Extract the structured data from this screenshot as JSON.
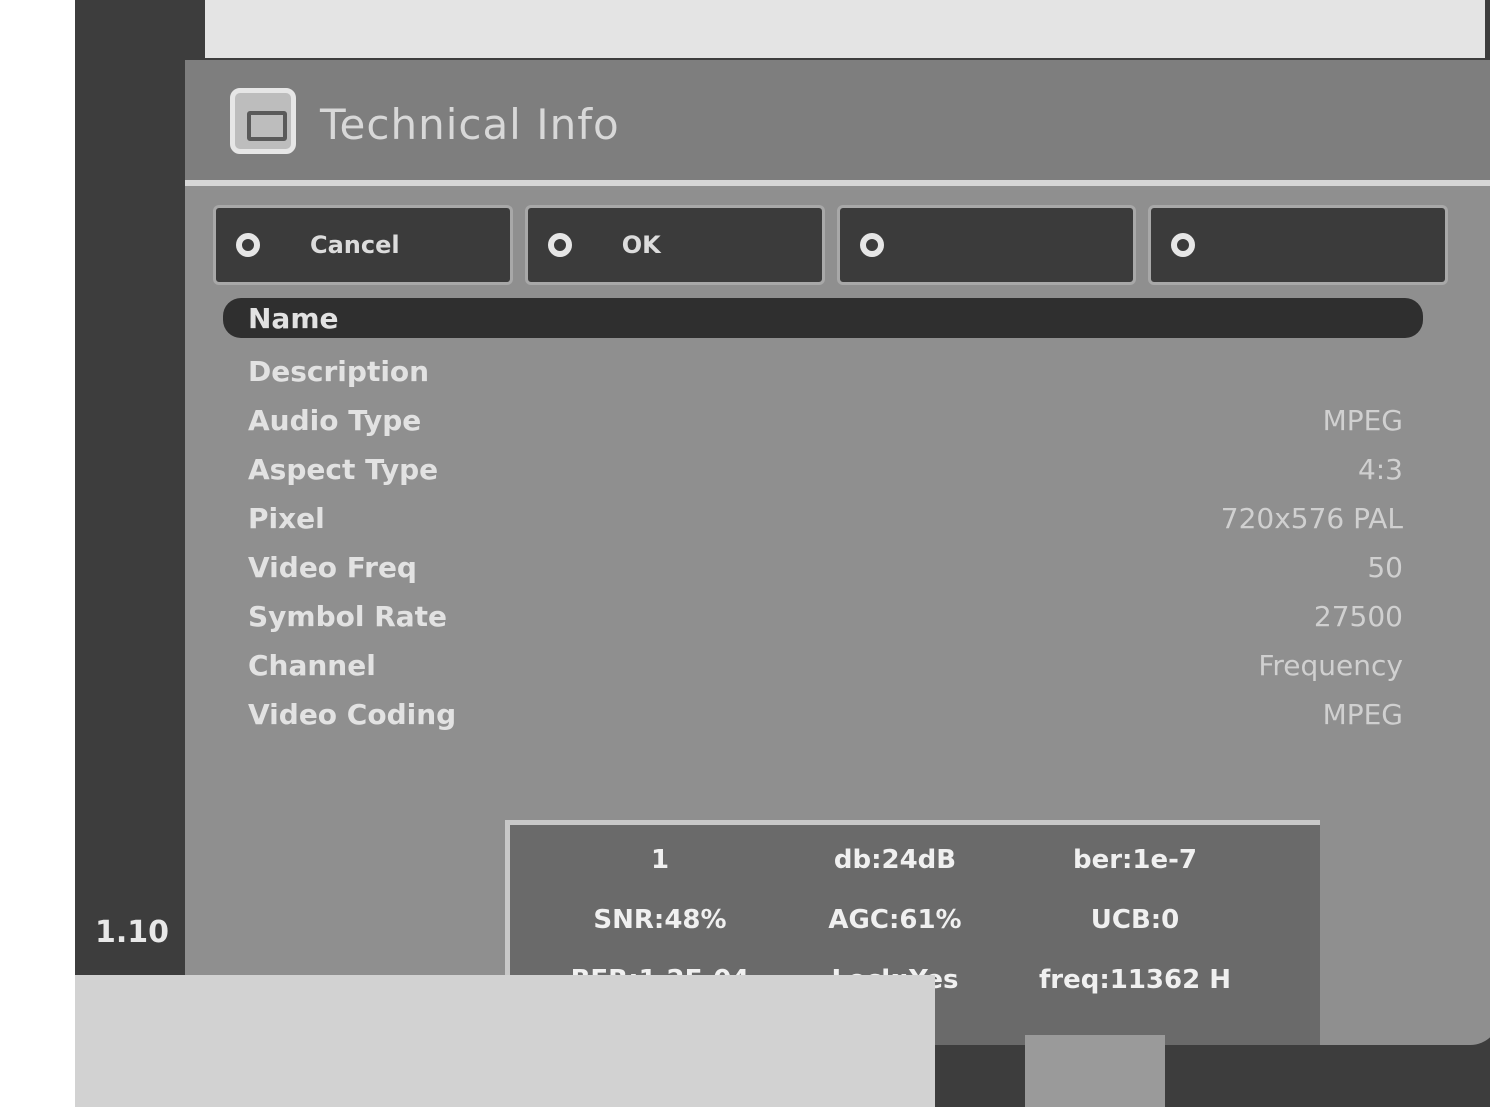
{
  "window": {
    "title": "Technical Info"
  },
  "color_keys": [
    {
      "label": "Cancel"
    },
    {
      "label": "OK"
    },
    {
      "label": ""
    },
    {
      "label": ""
    }
  ],
  "params": [
    {
      "label": "Name",
      "value": ""
    },
    {
      "label": "Description",
      "value": ""
    },
    {
      "label": "Audio Type",
      "value": "MPEG"
    },
    {
      "label": "Aspect Type",
      "value": "4:3"
    },
    {
      "label": "Pixel",
      "value": "720x576 PAL"
    },
    {
      "label": "Video Freq",
      "value": "50"
    },
    {
      "label": "Symbol Rate",
      "value": "27500"
    },
    {
      "label": "Channel",
      "value": "Frequency"
    },
    {
      "label": "Video Coding",
      "value": "MPEG"
    }
  ],
  "info_panel": {
    "cells": [
      "1",
      "db:24dB",
      "ber:1e-7",
      "SNR:48%",
      "AGC:61%",
      "UCB:0",
      "BER:1.2E-04",
      "Lock:Yes",
      "freq:11362 H"
    ]
  },
  "left_readout": "1.10"
}
